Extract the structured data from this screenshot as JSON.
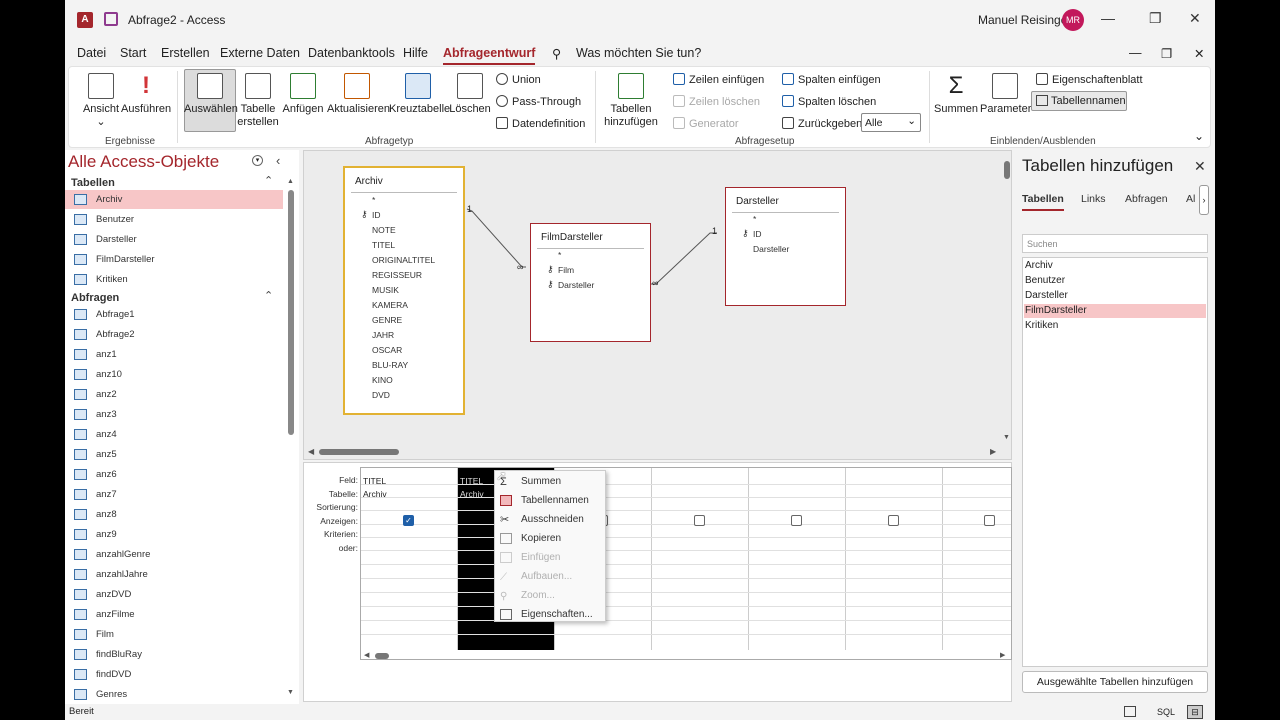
{
  "window": {
    "title": "Abfrage2  -  Access",
    "user": "Manuel Reisinger",
    "user_initials": "MR"
  },
  "menu": {
    "items": [
      "Datei",
      "Start",
      "Erstellen",
      "Externe Daten",
      "Datenbanktools",
      "Hilfe",
      "Abfrageentwurf"
    ],
    "search": "Was möchten Sie tun?"
  },
  "ribbon": {
    "ergebnisse": {
      "ansicht": "Ansicht",
      "ausfuehren": "Ausführen",
      "label": "Ergebnisse"
    },
    "abfragetyp": {
      "auswaehlen": "Auswählen",
      "tabelle_erstellen_1": "Tabelle",
      "tabelle_erstellen_2": "erstellen",
      "anfuegen": "Anfügen",
      "aktualisieren": "Aktualisieren",
      "kreuztabelle": "Kreuztabelle",
      "loeschen": "Löschen",
      "union": "Union",
      "pass_through": "Pass-Through",
      "datendefinition": "Datendefinition",
      "label": "Abfragetyp"
    },
    "abfragesetup": {
      "tabellen_hinzufuegen_1": "Tabellen",
      "tabellen_hinzufuegen_2": "hinzufügen",
      "zeilen_einfuegen": "Zeilen einfügen",
      "zeilen_loeschen": "Zeilen löschen",
      "generator": "Generator",
      "spalten_einfuegen": "Spalten einfügen",
      "spalten_loeschen": "Spalten löschen",
      "zurueckgeben": "Zurückgeben:",
      "zurueckgeben_value": "Alle",
      "label": "Abfragesetup"
    },
    "einblenden": {
      "summen": "Summen",
      "parameter": "Parameter",
      "eigenschaftenblatt": "Eigenschaftenblatt",
      "tabellennamen": "Tabellennamen",
      "label": "Einblenden/Ausblenden"
    }
  },
  "nav": {
    "title": "Alle Access-Objekte",
    "section_tabellen": "Tabellen",
    "tabellen": [
      "Archiv",
      "Benutzer",
      "Darsteller",
      "FilmDarsteller",
      "Kritiken"
    ],
    "section_abfragen": "Abfragen",
    "abfragen": [
      "Abfrage1",
      "Abfrage2",
      "anz1",
      "anz10",
      "anz2",
      "anz3",
      "anz4",
      "anz5",
      "anz6",
      "anz7",
      "anz8",
      "anz9",
      "anzahlGenre",
      "anzahlJahre",
      "anzDVD",
      "anzFilme",
      "Film",
      "findBluRay",
      "findDVD",
      "Genres"
    ]
  },
  "design": {
    "archiv": {
      "title": "Archiv",
      "fields": [
        "*",
        "ID",
        "NOTE",
        "TITEL",
        "ORIGINALTITEL",
        "REGISSEUR",
        "MUSIK",
        "KAMERA",
        "GENRE",
        "JAHR",
        "OSCAR",
        "BLU-RAY",
        "KINO",
        "DVD"
      ]
    },
    "filmdarsteller": {
      "title": "FilmDarsteller",
      "fields": [
        "*",
        "Film",
        "Darsteller"
      ]
    },
    "darsteller": {
      "title": "Darsteller",
      "fields": [
        "*",
        "ID",
        "Darsteller"
      ]
    }
  },
  "grid": {
    "row_labels": [
      "Feld:",
      "Tabelle:",
      "Sortierung:",
      "Anzeigen:",
      "Kriterien:",
      "oder:"
    ],
    "col1": {
      "feld": "TITEL",
      "tabelle": "Archiv"
    },
    "col2": {
      "feld": "TITEL",
      "tabelle": "Archiv"
    }
  },
  "context_menu": {
    "items": [
      "Summen",
      "Tabellennamen",
      "Ausschneiden",
      "Kopieren",
      "Einfügen",
      "Aufbauen...",
      "Zoom...",
      "Eigenschaften..."
    ]
  },
  "pane": {
    "title": "Tabellen hinzufügen",
    "tabs": [
      "Tabellen",
      "Links",
      "Abfragen",
      "Al"
    ],
    "search_placeholder": "Suchen",
    "items": [
      "Archiv",
      "Benutzer",
      "Darsteller",
      "FilmDarsteller",
      "Kritiken"
    ],
    "button": "Ausgewählte Tabellen hinzufügen"
  },
  "status": {
    "text": "Bereit",
    "sql": "SQL"
  },
  "colors": {
    "accent": "#a4262c",
    "selection": "#f7c6c7",
    "avatar": "#c2185b"
  }
}
